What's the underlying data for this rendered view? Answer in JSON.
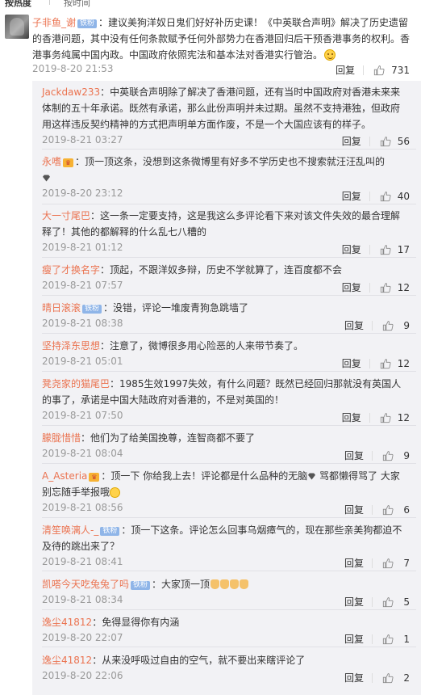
{
  "sort": {
    "hot": "按热度",
    "time": "按时间"
  },
  "top_comment": {
    "user": "子非鱼_谢",
    "badge": "铁粉",
    "text_line1": "：建议美狗洋奴日鬼们好好补历史课！《中英联合声明》解决了历史遗留",
    "text_line2": "的香港问题，其中没有任何条款赋予任何外部势力在香港回归后干预香港事务的权利。香",
    "text_line3": "港事务纯属中国内政。中国政府依照宪法和基本法对香港实行管治。",
    "emoji": "smile-emoji",
    "time": "2019-8-20 21:53",
    "reply": "回复",
    "likes": "731"
  },
  "replies": [
    {
      "user": "Jackdaw233",
      "badge": "",
      "vip": false,
      "lines": [
        "：中英联合声明除了解决了香港问题，还有当时中国政府对香港未来来",
        "体制的五十年承诺。既然有承诺，那么此份声明并未过期。虽然不支持港独，但政府",
        "用这样违反契约精神的方式把声明单方面作废，不是一个大国应该有的样子。"
      ],
      "time": "2019-8-21 03:27",
      "reply": "回复",
      "likes": "56"
    },
    {
      "user": "永嗜",
      "badge": "",
      "vip": true,
      "lines": [
        "：顶一顶这条，没想到这条微博里有好多不学历史也不搜索就汪汪乱叫的",
        ""
      ],
      "time": "2019-8-20 23:12",
      "reply": "回复",
      "likes": "40"
    },
    {
      "user": "大一寸尾巴",
      "badge": "",
      "vip": false,
      "lines": [
        "：这一条一定要支持，这是我这么多评论看下来对该文件失效的最合理解",
        "释了！其他的都解释的什么乱七八糟的"
      ],
      "time": "2019-8-21 01:12",
      "reply": "回复",
      "likes": "17"
    },
    {
      "user": "瘦了才换名字",
      "badge": "",
      "vip": false,
      "lines": [
        "：顶起，不跟洋奴多辩，历史不学就算了，连百度都不会"
      ],
      "time": "2019-8-21 07:57",
      "reply": "回复",
      "likes": "12"
    },
    {
      "user": "晴日滚滚",
      "badge": "铁粉",
      "vip": false,
      "lines": [
        "：没错，评论一堆废青狗急跳墙了"
      ],
      "time": "2019-8-21 08:38",
      "reply": "回复",
      "likes": "9"
    },
    {
      "user": "坚持泽东思想",
      "badge": "",
      "vip": false,
      "lines": [
        "：注意了，微博很多用心险恶的人来带节奏了。"
      ],
      "time": "2019-8-21 05:01",
      "reply": "回复",
      "likes": "12"
    },
    {
      "user": "凳尧家的猫尾巴",
      "badge": "",
      "vip": false,
      "lines": [
        "：1985生效1997失效，有什么问题？既然已经回归那就没有英国人",
        "的事了，承诺是中国大陆政府对香港的，不是对英国的！"
      ],
      "time": "2019-8-21 07:50",
      "reply": "回复",
      "likes": "12"
    },
    {
      "user": "朦胧惜惜",
      "badge": "",
      "vip": false,
      "lines": [
        "：他们为了给美国挽尊，连智商都不要了"
      ],
      "time": "2019-8-21 08:04",
      "reply": "回复",
      "likes": "9"
    },
    {
      "user": "A_Asteria",
      "badge": "",
      "vip": true,
      "lines": [
        "：顶一下 你给我上去！评论都是什么品种的无脑",
        "别忘随手举报哦"
      ],
      "line1_tail": " 骂都懒得骂了 大家",
      "time": "2019-8-21 08:56",
      "reply": "回复",
      "likes": "6"
    },
    {
      "user": "清笙唤漓人-_",
      "badge": "铁粉",
      "vip": false,
      "lines": [
        "：顶一下这条。评论怎么回事乌烟瘴气的，现在那些亲美狗都迫不",
        "及待的跳出来了？"
      ],
      "time": "2019-8-21 08:41",
      "reply": "回复",
      "likes": "7"
    },
    {
      "user": "凯嗒今天吃兔兔了吗",
      "badge": "铁粉",
      "vip": false,
      "lines": [
        "：大家顶一顶"
      ],
      "time": "2019-8-21 08:34",
      "reply": "回复",
      "likes": "5"
    },
    {
      "user": "逸尘41812",
      "badge": "",
      "vip": false,
      "lines": [
        "：免得显得你有内涵"
      ],
      "time": "2019-8-20 22:07",
      "reply": "回复",
      "likes": "1"
    },
    {
      "user": "逸尘41812",
      "badge": "",
      "vip": false,
      "lines": [
        "：从来没呼吸过自由的空气，就不要出来瞎评论了"
      ],
      "time": "2019-8-20 22:06",
      "reply": "回复",
      "likes": "2"
    }
  ]
}
